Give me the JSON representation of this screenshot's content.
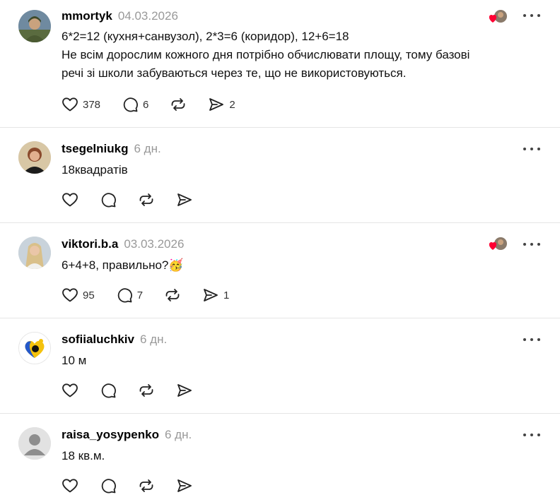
{
  "posts": [
    {
      "username": "mmortyk",
      "date": "04.03.2026",
      "text_lines": [
        "6*2=12 (кухня+санвузол), 2*3=6 (коридор), 12+6=18",
        "Не всім дорослим кожного дня потрібно обчислювати площу, тому базові",
        "речі зі школи забуваються через те, що не використовуються."
      ],
      "likes": "378",
      "replies": "6",
      "reposts": "",
      "shares": "2",
      "liked_by_author": true,
      "avatar": "avatar-photo-military"
    },
    {
      "username": "tsegelniukg",
      "date": "6 дн.",
      "text_lines": [
        "18квадратів"
      ],
      "likes": "",
      "replies": "",
      "reposts": "",
      "shares": "",
      "liked_by_author": false,
      "avatar": "avatar-photo-woman"
    },
    {
      "username": "viktori.b.a",
      "date": "03.03.2026",
      "text_lines": [
        "6+4+8, правильно?🥳"
      ],
      "likes": "95",
      "replies": "7",
      "reposts": "",
      "shares": "1",
      "liked_by_author": true,
      "avatar": "avatar-photo-blonde"
    },
    {
      "username": "sofiialuchkiv",
      "date": "6 дн.",
      "text_lines": [
        "10 м"
      ],
      "likes": "",
      "replies": "",
      "reposts": "",
      "shares": "",
      "liked_by_author": false,
      "avatar": "avatar-heart-yellow-blue"
    },
    {
      "username": "raisa_yosypenko",
      "date": "6 дн.",
      "text_lines": [
        "18 кв.м."
      ],
      "likes": "",
      "replies": "",
      "reposts": "",
      "shares": "",
      "liked_by_author": false,
      "avatar": "avatar-default-placeholder"
    }
  ],
  "icons": {
    "like": "heart-icon",
    "reply": "comment-bubble-icon",
    "repost": "repost-arrows-icon",
    "share": "send-paper-plane-icon",
    "more": "more-dots-icon"
  },
  "colors": {
    "heart_red": "#ff0033",
    "muted": "#999999",
    "divider": "#e5e5e5"
  }
}
